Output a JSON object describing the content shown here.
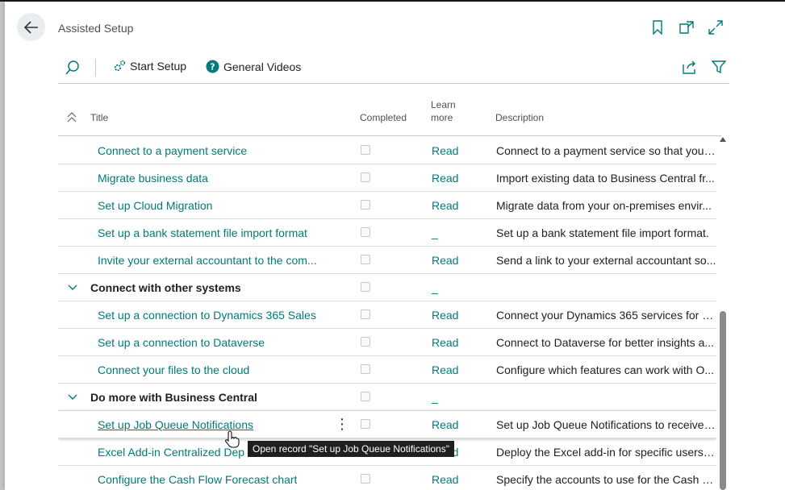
{
  "header": {
    "title": "Assisted Setup"
  },
  "toolbar": {
    "start_setup_label": "Start Setup",
    "general_videos_label": "General Videos"
  },
  "columns": {
    "title": "Title",
    "completed": "Completed",
    "learn_more_line1": "Learn",
    "learn_more_line2": "more",
    "description": "Description"
  },
  "rows": [
    {
      "type": "item",
      "title": "Connect to a payment service",
      "learn": "Read",
      "desc": "Connect to a payment service so that your..."
    },
    {
      "type": "item",
      "title": "Migrate business data",
      "learn": "Read",
      "desc": "Import existing data to Business Central fr..."
    },
    {
      "type": "item",
      "title": "Set up Cloud Migration",
      "learn": "Read",
      "desc": "Migrate data from your on-premises envir..."
    },
    {
      "type": "item",
      "title": "Set up a bank statement file import format",
      "learn": "_",
      "desc": "Set up a bank statement file import format."
    },
    {
      "type": "item",
      "title": "Invite your external accountant to the com...",
      "learn": "Read",
      "desc": "Send a link to your external accountant so..."
    },
    {
      "type": "group",
      "title": "Connect with other systems",
      "learn": "_",
      "desc": ""
    },
    {
      "type": "item",
      "title": "Set up a connection to Dynamics 365 Sales",
      "learn": "Read",
      "desc": "Connect your Dynamics 365 services for b..."
    },
    {
      "type": "item",
      "title": "Set up a connection to Dataverse",
      "learn": "Read",
      "desc": "Connect to Dataverse for better insights a..."
    },
    {
      "type": "item",
      "title": "Connect your files to the cloud",
      "learn": "Read",
      "desc": "Configure which features can work with O..."
    },
    {
      "type": "group",
      "title": "Do more with Business Central",
      "learn": "_",
      "desc": ""
    },
    {
      "type": "item",
      "title": "Set up Job Queue Notifications",
      "learn": "Read",
      "desc": "Set up Job Queue Notifications to receive ..."
    },
    {
      "type": "item",
      "title": "Excel Add-in Centralized Dep",
      "learn": "Read",
      "desc": "Deploy the Excel add-in for specific users, ..."
    },
    {
      "type": "item",
      "title": "Configure the Cash Flow Forecast chart",
      "learn": "Read",
      "desc": "Specify the accounts to use for the Cash Fl..."
    }
  ],
  "tooltip": "Open record \"Set up Job Queue Notifications\"",
  "colors": {
    "accent": "#007a7a",
    "text": "#212121"
  }
}
